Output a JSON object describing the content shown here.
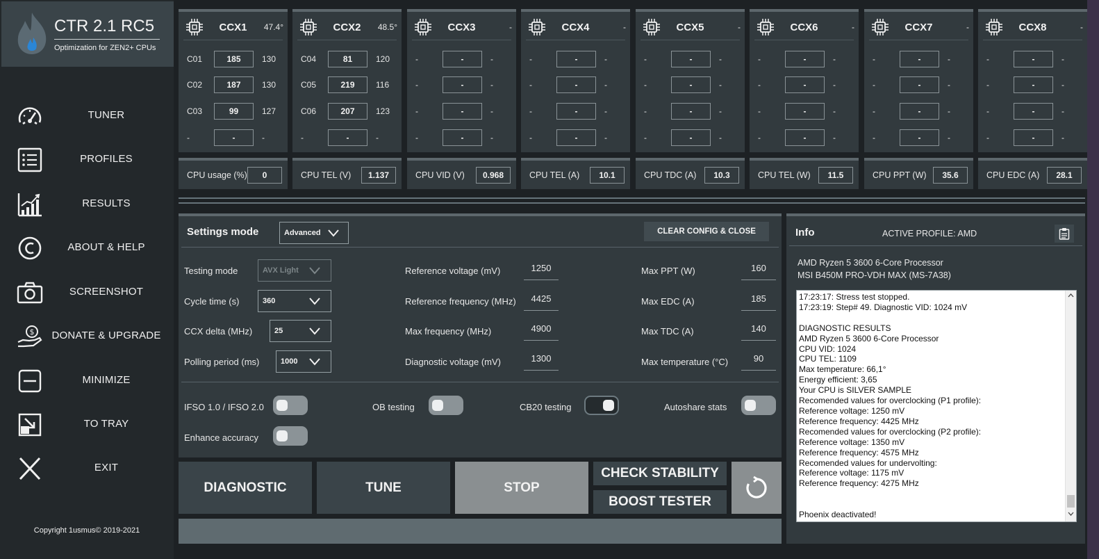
{
  "app": {
    "title": "CTR 2.1 RC5",
    "subtitle": "Optimization for ZEN2+ CPUs",
    "copyright": "Copyright 1usmus© 2019-2021"
  },
  "nav": [
    {
      "label": "TUNER",
      "icon": "speedometer-icon"
    },
    {
      "label": "PROFILES",
      "icon": "list-icon"
    },
    {
      "label": "RESULTS",
      "icon": "bar-chart-icon"
    },
    {
      "label": "ABOUT & HELP",
      "icon": "copyright-icon"
    },
    {
      "label": "SCREENSHOT",
      "icon": "camera-icon"
    },
    {
      "label": "DONATE & UPGRADE",
      "icon": "donate-hand-icon"
    },
    {
      "label": "MINIMIZE",
      "icon": "minimize-icon"
    },
    {
      "label": "TO TRAY",
      "icon": "tray-icon"
    },
    {
      "label": "EXIT",
      "icon": "close-x-icon"
    }
  ],
  "ccx": [
    {
      "name": "CCX1",
      "temp": "47.4°",
      "cores": [
        {
          "name": "C01",
          "box": "185",
          "val": "130"
        },
        {
          "name": "C02",
          "box": "187",
          "val": "130"
        },
        {
          "name": "C03",
          "box": "99",
          "val": "127"
        },
        {
          "name": "-",
          "box": "-",
          "val": "-"
        }
      ]
    },
    {
      "name": "CCX2",
      "temp": "48.5°",
      "cores": [
        {
          "name": "C04",
          "box": "81",
          "val": "120"
        },
        {
          "name": "C05",
          "box": "219",
          "val": "116"
        },
        {
          "name": "C06",
          "box": "207",
          "val": "123"
        },
        {
          "name": "-",
          "box": "-",
          "val": "-"
        }
      ]
    },
    {
      "name": "CCX3",
      "temp": "-",
      "cores": [
        {
          "name": "-",
          "box": "-",
          "val": "-"
        },
        {
          "name": "-",
          "box": "-",
          "val": "-"
        },
        {
          "name": "-",
          "box": "-",
          "val": "-"
        },
        {
          "name": "-",
          "box": "-",
          "val": "-"
        }
      ]
    },
    {
      "name": "CCX4",
      "temp": "-",
      "cores": [
        {
          "name": "-",
          "box": "-",
          "val": "-"
        },
        {
          "name": "-",
          "box": "-",
          "val": "-"
        },
        {
          "name": "-",
          "box": "-",
          "val": "-"
        },
        {
          "name": "-",
          "box": "-",
          "val": "-"
        }
      ]
    },
    {
      "name": "CCX5",
      "temp": "-",
      "cores": [
        {
          "name": "-",
          "box": "-",
          "val": "-"
        },
        {
          "name": "-",
          "box": "-",
          "val": "-"
        },
        {
          "name": "-",
          "box": "-",
          "val": "-"
        },
        {
          "name": "-",
          "box": "-",
          "val": "-"
        }
      ]
    },
    {
      "name": "CCX6",
      "temp": "-",
      "cores": [
        {
          "name": "-",
          "box": "-",
          "val": "-"
        },
        {
          "name": "-",
          "box": "-",
          "val": "-"
        },
        {
          "name": "-",
          "box": "-",
          "val": "-"
        },
        {
          "name": "-",
          "box": "-",
          "val": "-"
        }
      ]
    },
    {
      "name": "CCX7",
      "temp": "-",
      "cores": [
        {
          "name": "-",
          "box": "-",
          "val": "-"
        },
        {
          "name": "-",
          "box": "-",
          "val": "-"
        },
        {
          "name": "-",
          "box": "-",
          "val": "-"
        },
        {
          "name": "-",
          "box": "-",
          "val": "-"
        }
      ]
    },
    {
      "name": "CCX8",
      "temp": "-",
      "cores": [
        {
          "name": "-",
          "box": "-",
          "val": "-"
        },
        {
          "name": "-",
          "box": "-",
          "val": "-"
        },
        {
          "name": "-",
          "box": "-",
          "val": "-"
        },
        {
          "name": "-",
          "box": "-",
          "val": "-"
        }
      ]
    }
  ],
  "readouts": [
    {
      "label": "CPU usage (%)",
      "value": "0"
    },
    {
      "label": "CPU TEL (V)",
      "value": "1.137"
    },
    {
      "label": "CPU VID (V)",
      "value": "0.968"
    },
    {
      "label": "CPU TEL (A)",
      "value": "10.1"
    },
    {
      "label": "CPU TDC (A)",
      "value": "10.3"
    },
    {
      "label": "CPU TEL (W)",
      "value": "11.5"
    },
    {
      "label": "CPU PPT (W)",
      "value": "35.6"
    },
    {
      "label": "CPU EDC (A)",
      "value": "28.1"
    }
  ],
  "settings": {
    "title": "Settings mode",
    "mode": "Advanced",
    "clear_button": "CLEAR CONFIG & CLOSE",
    "testing_mode_label": "Testing mode",
    "testing_mode_value": "AVX Light",
    "cycle_time_label": "Cycle time (s)",
    "cycle_time_value": "360",
    "ccx_delta_label": "CCX delta (MHz)",
    "ccx_delta_value": "25",
    "polling_label": "Polling period (ms)",
    "polling_value": "1000",
    "ref_voltage_label": "Reference voltage (mV)",
    "ref_voltage_value": "1250",
    "ref_freq_label": "Reference frequency (MHz)",
    "ref_freq_value": "4425",
    "max_freq_label": "Max frequency (MHz)",
    "max_freq_value": "4900",
    "diag_voltage_label": "Diagnostic voltage (mV)",
    "diag_voltage_value": "1300",
    "max_ppt_label": "Max PPT (W)",
    "max_ppt_value": "160",
    "max_edc_label": "Max EDC (A)",
    "max_edc_value": "185",
    "max_tdc_label": "Max TDC (A)",
    "max_tdc_value": "140",
    "max_temp_label": "Max temperature (°C)",
    "max_temp_value": "90",
    "ifso_label": "IFSO 1.0 / IFSO 2.0",
    "ob_label": "OB testing",
    "cb20_label": "CB20 testing",
    "autoshare_label": "Autoshare stats",
    "enhance_label": "Enhance accuracy",
    "ifso_on": false,
    "ob_on": false,
    "cb20_on": true,
    "autoshare_on": false,
    "enhance_on": false
  },
  "actions": {
    "diagnostic": "DIAGNOSTIC",
    "tune": "TUNE",
    "stop": "STOP",
    "check_stability": "CHECK STABILITY",
    "boost_tester": "BOOST TESTER"
  },
  "info": {
    "title": "Info",
    "active_profile": "ACTIVE PROFILE: AMD",
    "cpu": "AMD Ryzen 5 3600 6-Core Processor",
    "board": "MSI B450M PRO-VDH MAX (MS-7A38)",
    "log": "17:23:17: Stress test stopped.\n17:23:19: Step# 49. Diagnostic VID: 1024 mV\n\nDIAGNOSTIC RESULTS\nAMD Ryzen 5 3600 6-Core Processor\nCPU VID: 1024\nCPU TEL: 1109\nMax temperature: 66,1°\nEnergy efficient: 3,65\nYour CPU is SILVER SAMPLE\nRecomended values for overclocking (P1 profile):\nReference voltage: 1250 mV\nReference frequency: 4425 MHz\nRecomended values for overclocking (P2 profile):\nReference voltage: 1350 mV\nReference frequency: 4575 MHz\nRecomended values for undervolting:\nReference voltage: 1175 mV\nReference frequency: 4275 MHz\n\n\nPhoenix deactivated!"
  },
  "colors": {
    "background": "#1d2124",
    "panel": "#323a3e",
    "button": "#3a4449",
    "stop_button": "#8a8f91",
    "progress": "#5f6b70"
  }
}
